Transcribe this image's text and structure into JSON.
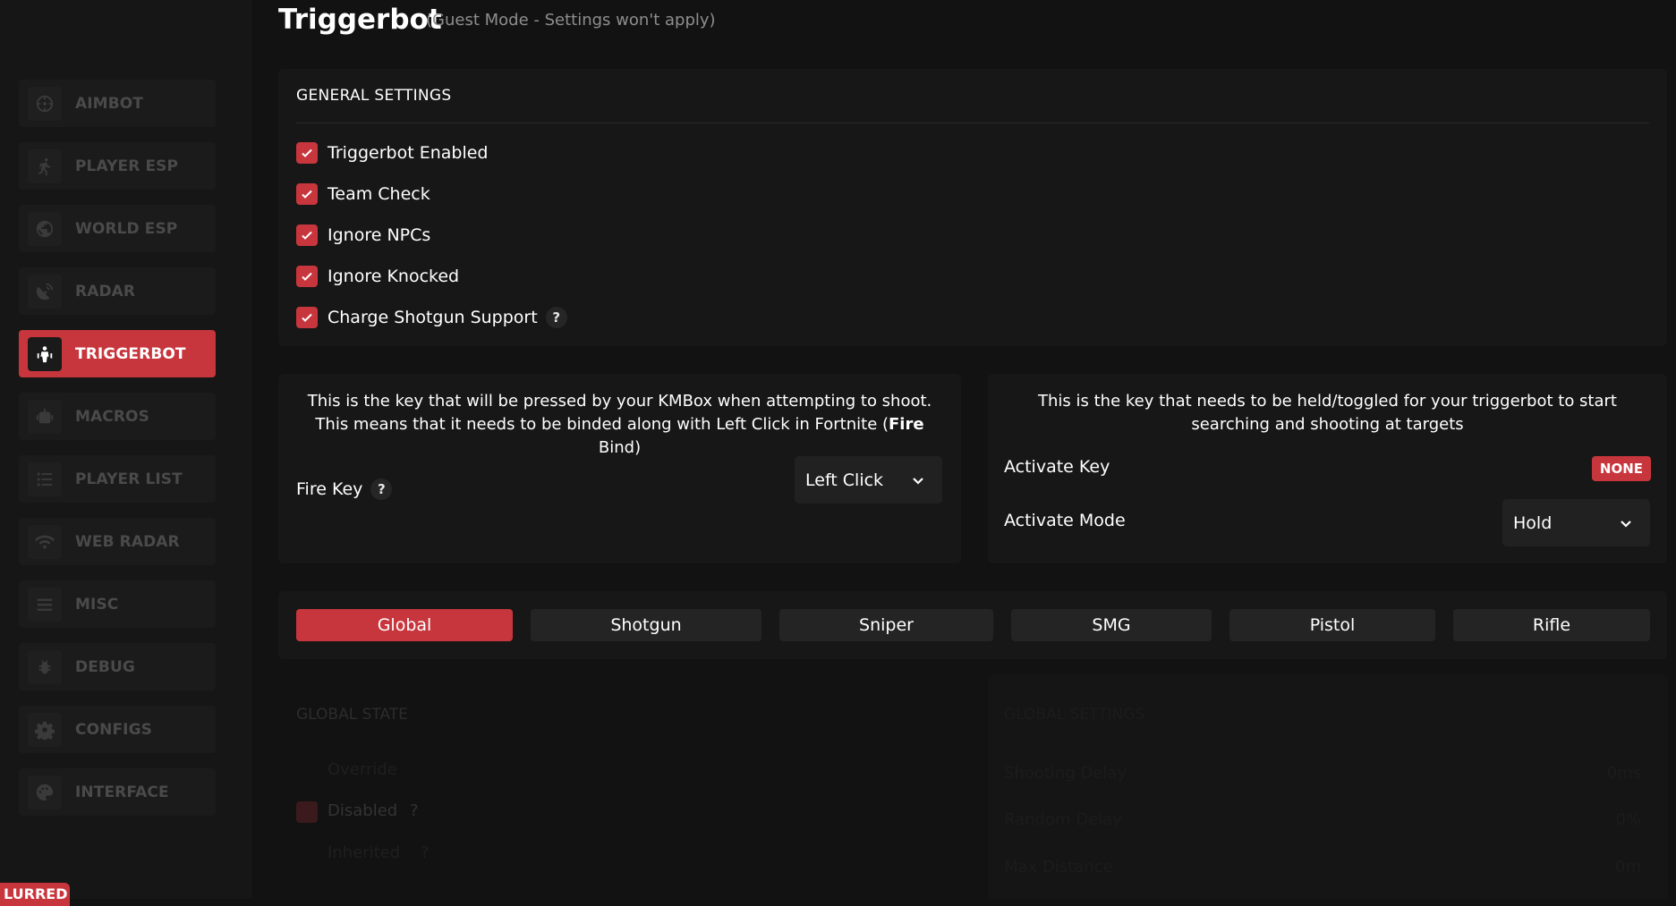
{
  "sidebar": {
    "items": [
      {
        "label": "AIMBOT",
        "icon": "crosshair-icon"
      },
      {
        "label": "PLAYER ESP",
        "icon": "running-person-icon"
      },
      {
        "label": "WORLD ESP",
        "icon": "globe-icon"
      },
      {
        "label": "RADAR",
        "icon": "satellite-dish-icon"
      },
      {
        "label": "TRIGGERBOT",
        "icon": "person-target-icon",
        "active": true
      },
      {
        "label": "MACROS",
        "icon": "robot-icon"
      },
      {
        "label": "PLAYER LIST",
        "icon": "list-icon"
      },
      {
        "label": "WEB RADAR",
        "icon": "wifi-icon"
      },
      {
        "label": "MISC",
        "icon": "menu-icon"
      },
      {
        "label": "DEBUG",
        "icon": "bug-icon"
      },
      {
        "label": "CONFIGS",
        "icon": "gear-icon"
      },
      {
        "label": "INTERFACE",
        "icon": "palette-icon"
      }
    ],
    "corner_badge": "LURRED"
  },
  "header": {
    "title": "Triggerbot",
    "subtitle": "(Guest Mode - Settings won't apply)"
  },
  "general": {
    "heading": "GENERAL SETTINGS",
    "options": [
      {
        "label": "Triggerbot Enabled",
        "checked": true
      },
      {
        "label": "Team Check",
        "checked": true
      },
      {
        "label": "Ignore NPCs",
        "checked": true
      },
      {
        "label": "Ignore Knocked",
        "checked": true
      },
      {
        "label": "Charge Shotgun Support",
        "checked": true,
        "help": "?"
      }
    ]
  },
  "fire": {
    "desc_part1": "This is the key that will be pressed by your KMBox when attempting to shoot. This means that it needs to be binded along with Left Click in Fortnite (",
    "desc_bold": "Fire",
    "desc_part2": " Bind)",
    "label": "Fire Key",
    "help": "?",
    "value": "Left Click"
  },
  "activate": {
    "desc": "This is the key that needs to be held/toggled for your triggerbot to start searching and shooting at targets",
    "key_label": "Activate Key",
    "key_value": "NONE",
    "mode_label": "Activate Mode",
    "mode_value": "Hold"
  },
  "weapon_tabs": [
    "Global",
    "Shotgun",
    "Sniper",
    "SMG",
    "Pistol",
    "Rifle"
  ],
  "active_tab": "Global",
  "global_state": {
    "heading": "GLOBAL STATE",
    "option1": "Override",
    "option2": "Disabled",
    "option2_help": "?",
    "option3": "Inherited",
    "option3_help": "?"
  },
  "global_settings": {
    "heading": "GLOBAL SETTINGS",
    "rows": [
      {
        "label": "Shooting Delay",
        "value": "0ms"
      },
      {
        "label": "Random Delay",
        "value": "0%"
      },
      {
        "label": "Max Distance",
        "value": "0m"
      }
    ]
  },
  "colors": {
    "accent": "#c8363d",
    "background": "#121212",
    "panel": "#171717"
  }
}
